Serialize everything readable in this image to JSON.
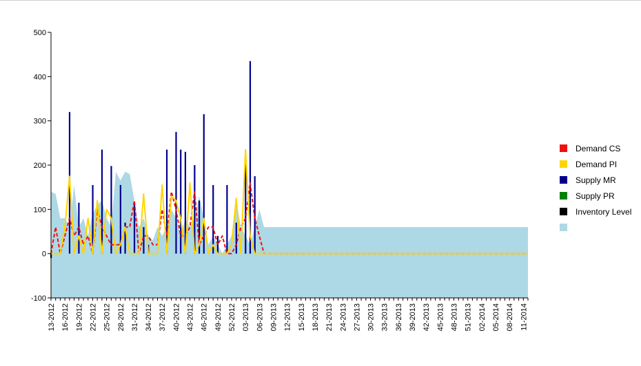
{
  "chart_data": {
    "type": "bar",
    "title": "",
    "xlabel": "",
    "ylabel": "",
    "ylim": [
      -100,
      500
    ],
    "yticks": [
      -100,
      0,
      100,
      200,
      300,
      400,
      500
    ],
    "grid": false,
    "legend_position": "right",
    "categories": [
      "13-2012",
      "16-2012",
      "19-2012",
      "22-2012",
      "25-2012",
      "28-2012",
      "31-2012",
      "34-2012",
      "37-2012",
      "40-2012",
      "43-2012",
      "46-2012",
      "49-2012",
      "52-2012",
      "03-2013",
      "06-2013",
      "09-2013",
      "12-2013",
      "15-2013",
      "18-2013",
      "21-2013",
      "24-2013",
      "27-2013",
      "30-2013",
      "33-2013",
      "36-2013",
      "39-2013",
      "42-2013",
      "45-2013",
      "48-2013",
      "51-2013",
      "02-2014",
      "05-2014",
      "08-2014",
      "11-2014"
    ],
    "x_weeks_total": 103,
    "series": [
      {
        "name": "Demand CS",
        "kind": "line-dashed",
        "color": "#ee1111",
        "x": [
          0,
          1,
          2,
          3,
          4,
          5,
          6,
          7,
          8,
          9,
          10,
          11,
          12,
          13,
          14,
          15,
          16,
          17,
          18,
          19,
          20,
          21,
          22,
          23,
          24,
          25,
          26,
          27,
          28,
          29,
          30,
          31,
          32,
          33,
          34,
          35,
          36,
          37,
          38,
          39,
          40,
          41,
          42,
          43,
          44,
          45,
          46,
          47,
          48,
          49,
          103
        ],
        "values": [
          0,
          60,
          0,
          40,
          80,
          40,
          60,
          20,
          40,
          0,
          100,
          60,
          40,
          20,
          20,
          20,
          60,
          60,
          120,
          0,
          40,
          40,
          20,
          20,
          100,
          40,
          140,
          100,
          40,
          40,
          60,
          140,
          20,
          40,
          60,
          60,
          20,
          40,
          0,
          0,
          20,
          60,
          80,
          160,
          80,
          40,
          0,
          0,
          0,
          0,
          0
        ]
      },
      {
        "name": "Demand PI",
        "kind": "line",
        "color": "#ffd500",
        "x": [
          0,
          1,
          2,
          3,
          4,
          5,
          6,
          7,
          8,
          9,
          10,
          11,
          12,
          13,
          14,
          15,
          16,
          17,
          18,
          19,
          20,
          21,
          22,
          23,
          24,
          25,
          26,
          27,
          28,
          29,
          30,
          31,
          32,
          33,
          34,
          35,
          36,
          37,
          38,
          39,
          40,
          41,
          42,
          43,
          44,
          45,
          46,
          47,
          48,
          49,
          103
        ],
        "values": [
          0,
          0,
          0,
          60,
          175,
          0,
          40,
          0,
          80,
          0,
          120,
          0,
          100,
          80,
          0,
          20,
          60,
          0,
          0,
          0,
          135,
          0,
          0,
          0,
          155,
          0,
          130,
          120,
          80,
          0,
          160,
          0,
          20,
          80,
          0,
          20,
          0,
          0,
          0,
          20,
          125,
          0,
          235,
          40,
          0,
          0,
          0,
          0,
          0,
          0,
          0
        ]
      },
      {
        "name": "Supply MR",
        "kind": "bar",
        "color": "#00008b",
        "x": [
          4,
          6,
          9,
          11,
          13,
          15,
          16,
          18,
          20,
          21,
          25,
          27,
          28,
          29,
          31,
          32,
          33,
          35,
          36,
          38,
          40,
          42,
          43,
          44
        ],
        "values": [
          320,
          115,
          155,
          235,
          198,
          155,
          70,
          115,
          60,
          20,
          235,
          275,
          235,
          230,
          200,
          120,
          315,
          155,
          40,
          155,
          70,
          220,
          435,
          175
        ]
      },
      {
        "name": "Supply PR",
        "kind": "bar",
        "color": "#008000",
        "x": [],
        "values": []
      },
      {
        "name": "Inventory Level",
        "kind": "bar",
        "color": "#000000",
        "x": [
          0
        ],
        "values": [
          -10
        ]
      },
      {
        "name": "",
        "kind": "area",
        "color": "#add8e6",
        "x": [
          0,
          1,
          2,
          3,
          4,
          5,
          6,
          7,
          8,
          9,
          10,
          11,
          12,
          13,
          14,
          15,
          16,
          17,
          18,
          19,
          20,
          21,
          22,
          23,
          24,
          25,
          26,
          27,
          28,
          29,
          30,
          31,
          32,
          33,
          34,
          35,
          36,
          37,
          38,
          39,
          40,
          41,
          42,
          43,
          44,
          45,
          46,
          47,
          103
        ],
        "values": [
          140,
          135,
          80,
          80,
          60,
          155,
          60,
          80,
          40,
          90,
          110,
          120,
          80,
          60,
          185,
          165,
          185,
          180,
          120,
          60,
          80,
          40,
          30,
          60,
          40,
          60,
          100,
          80,
          40,
          80,
          60,
          80,
          130,
          80,
          20,
          40,
          20,
          0,
          20,
          40,
          120,
          60,
          40,
          20,
          60,
          100,
          60,
          60,
          60
        ]
      }
    ]
  }
}
